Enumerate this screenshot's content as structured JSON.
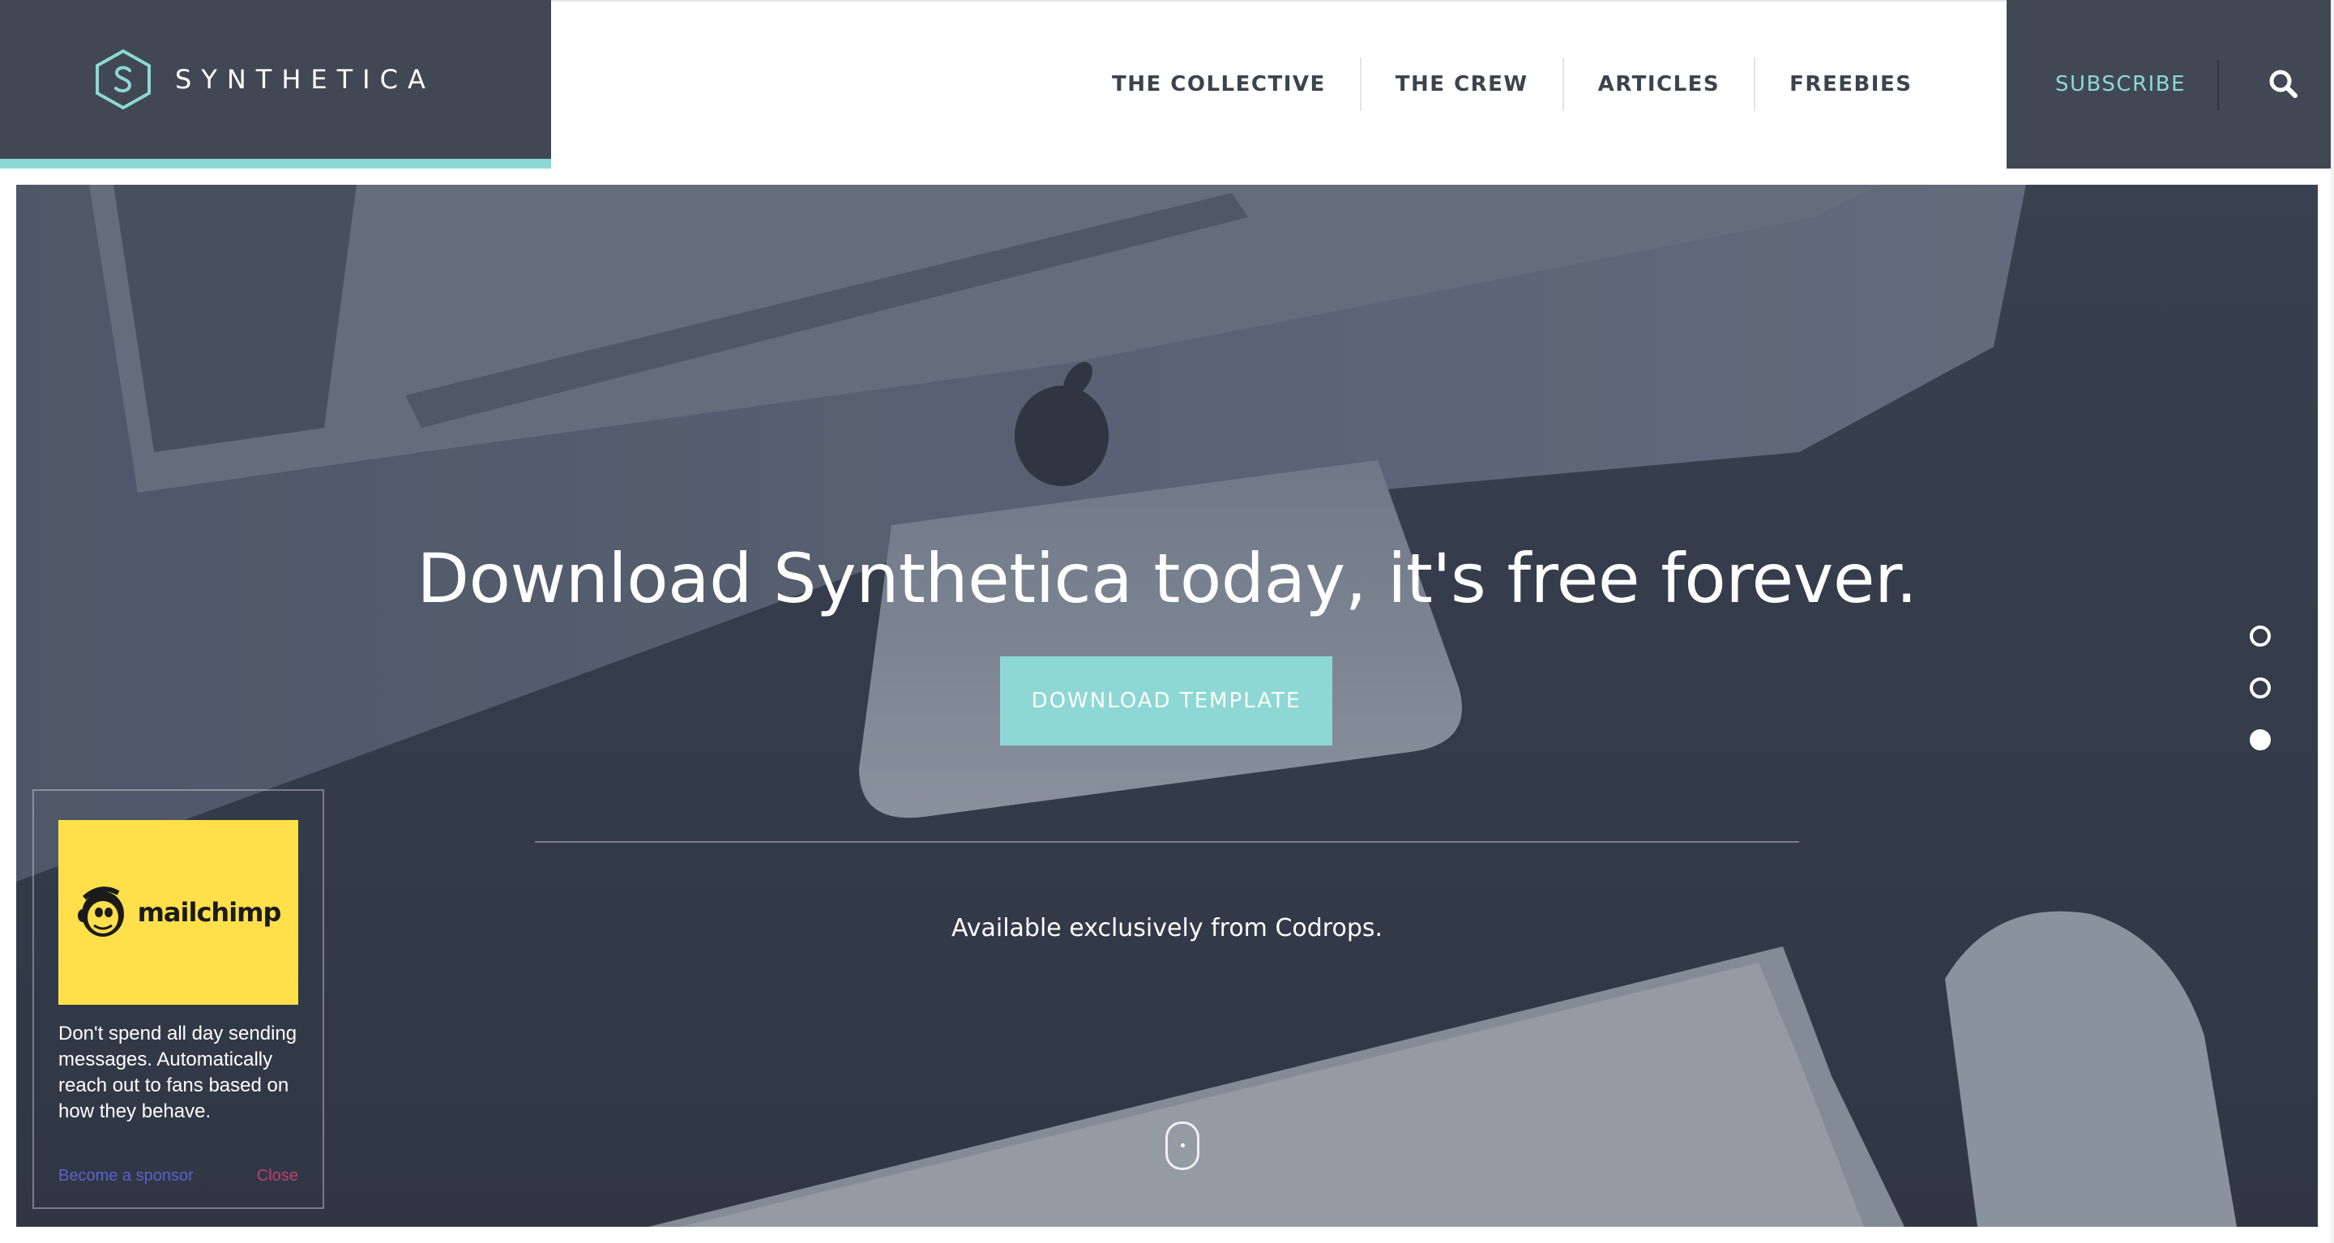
{
  "header": {
    "brand_name": "SYNTHETICA",
    "nav": [
      {
        "label": "THE COLLECTIVE"
      },
      {
        "label": "THE CREW"
      },
      {
        "label": "ARTICLES"
      },
      {
        "label": "FREEBIES"
      }
    ],
    "subscribe_label": "SUBSCRIBE",
    "search_icon": "search-icon"
  },
  "hero": {
    "title": "Download Synthetica today, it's free forever.",
    "cta_label": "DOWNLOAD TEMPLATE",
    "subtitle": "Available exclusively from Codrops.",
    "slides": {
      "count": 3,
      "active_index": 2
    }
  },
  "ad": {
    "brand": "mailchimp",
    "text": "Don't spend all day sending messages. Automatically reach out to fans based on how they behave.",
    "sponsor_label": "Become a sponsor",
    "close_label": "Close"
  },
  "colors": {
    "dark": "#414854",
    "accent": "#8dd8d4",
    "ad_yellow": "#ffe04b",
    "link_blue": "#5a63c8",
    "close_red": "#c0406a"
  }
}
